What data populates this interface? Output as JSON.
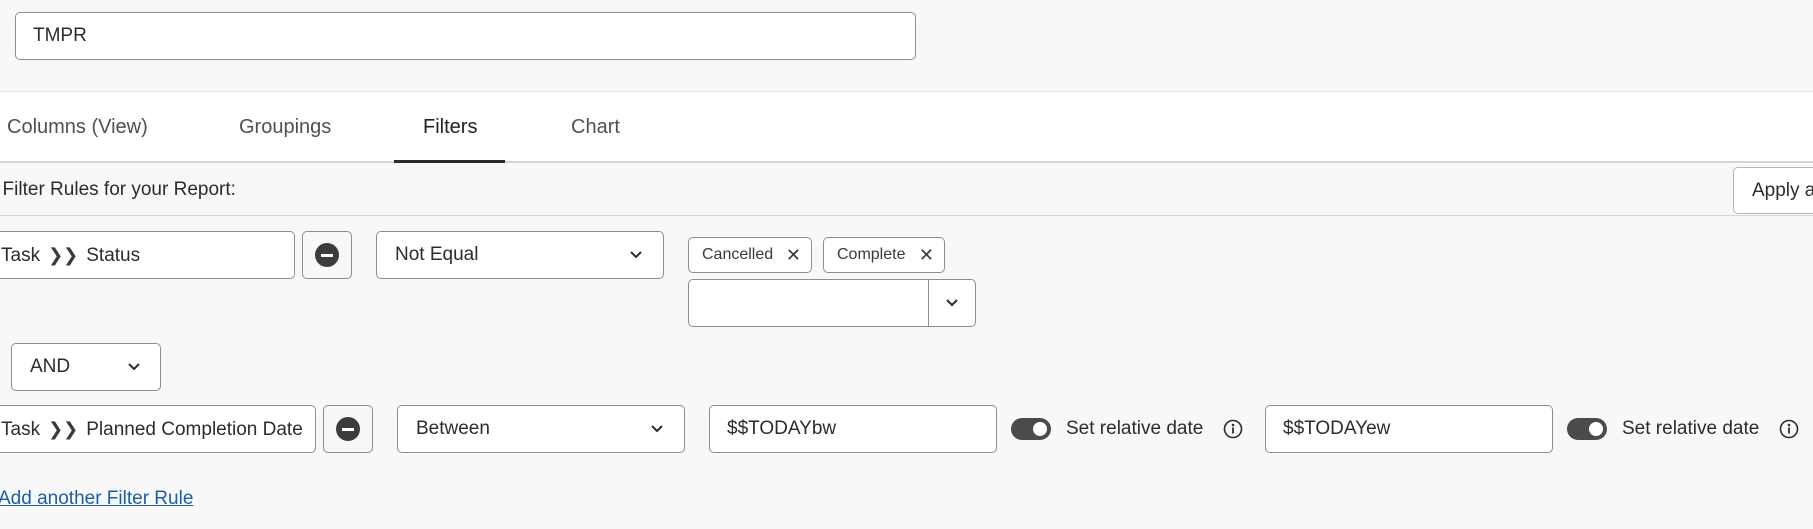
{
  "report": {
    "name_value": "TMPR"
  },
  "tabs": [
    {
      "label": "Columns (View)"
    },
    {
      "label": "Groupings"
    },
    {
      "label": "Filters"
    },
    {
      "label": "Chart"
    }
  ],
  "active_tab": "Filters",
  "filters": {
    "header_label": "t Filter Rules for your Report:",
    "apply_button_label": "Apply a",
    "rules": [
      {
        "field_object": "Task",
        "field_name": "Status",
        "operator": "Not Equal",
        "tags": [
          {
            "label": "Cancelled",
            "remove": "✕"
          },
          {
            "label": "Complete",
            "remove": "✕"
          }
        ],
        "combo_value": ""
      },
      {
        "field_object": "Task",
        "field_name": "Planned Completion Date",
        "operator": "Between",
        "start_value": "$$TODAYbw",
        "start_relative_label": "Set relative date",
        "end_value": "$$TODAYew",
        "end_relative_label": "Set relative date"
      }
    ],
    "connector": "AND",
    "add_rule_label": "Add another Filter Rule"
  }
}
